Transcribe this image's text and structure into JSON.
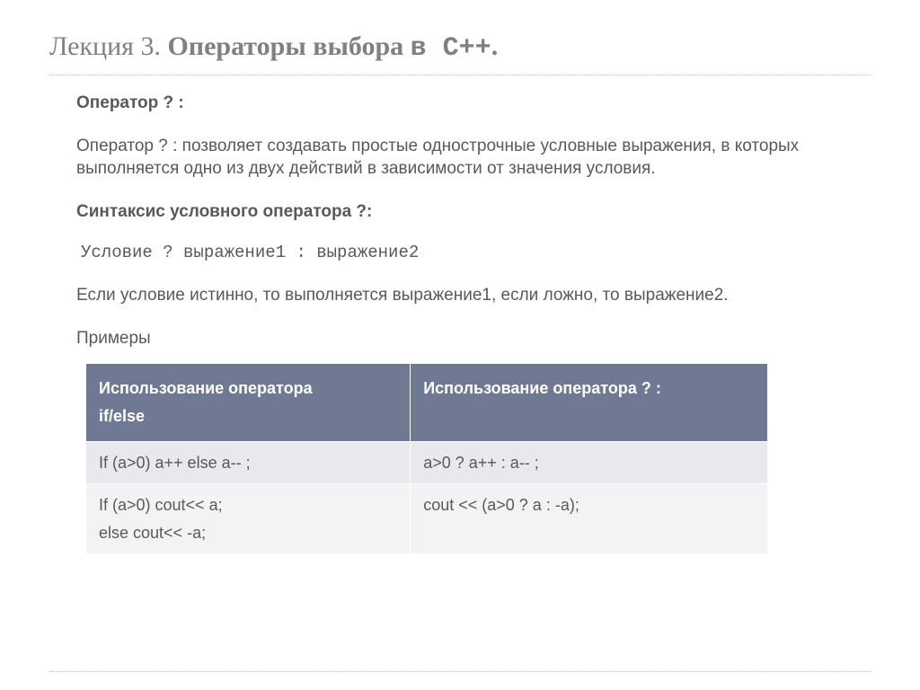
{
  "title": {
    "prefix": "Лекция 3. ",
    "bold": "Операторы выбора ",
    "mono": "в С++",
    "suffix": "."
  },
  "section_header": "Оператор ? :",
  "paragraph1": "Оператор ? :  позволяет создавать простые однострочные условные выражения, в которых выполняется одно из двух действий в зависимости от значения условия.",
  "syntax_header": "Синтаксис условного оператора ?:",
  "code_syntax": "Условие ?  выражение1 : выражение2",
  "paragraph2": "Если условие истинно, то выполняется выражение1, если ложно, то выражение2.",
  "examples_label": "Примеры",
  "table": {
    "headers": {
      "col1_line1": "Использование оператора",
      "col1_line2": "if/else",
      "col2": "Использование оператора ? :"
    },
    "rows": [
      {
        "col1": "If (a>0) a++ else a-- ;",
        "col2": "a>0 ? a++ : a-- ;"
      },
      {
        "col1_line1": "If (a>0)   cout<< a;",
        "col1_line2": "else    cout<< -a;",
        "col2": "cout << (a>0 ? a : -a);"
      }
    ]
  }
}
